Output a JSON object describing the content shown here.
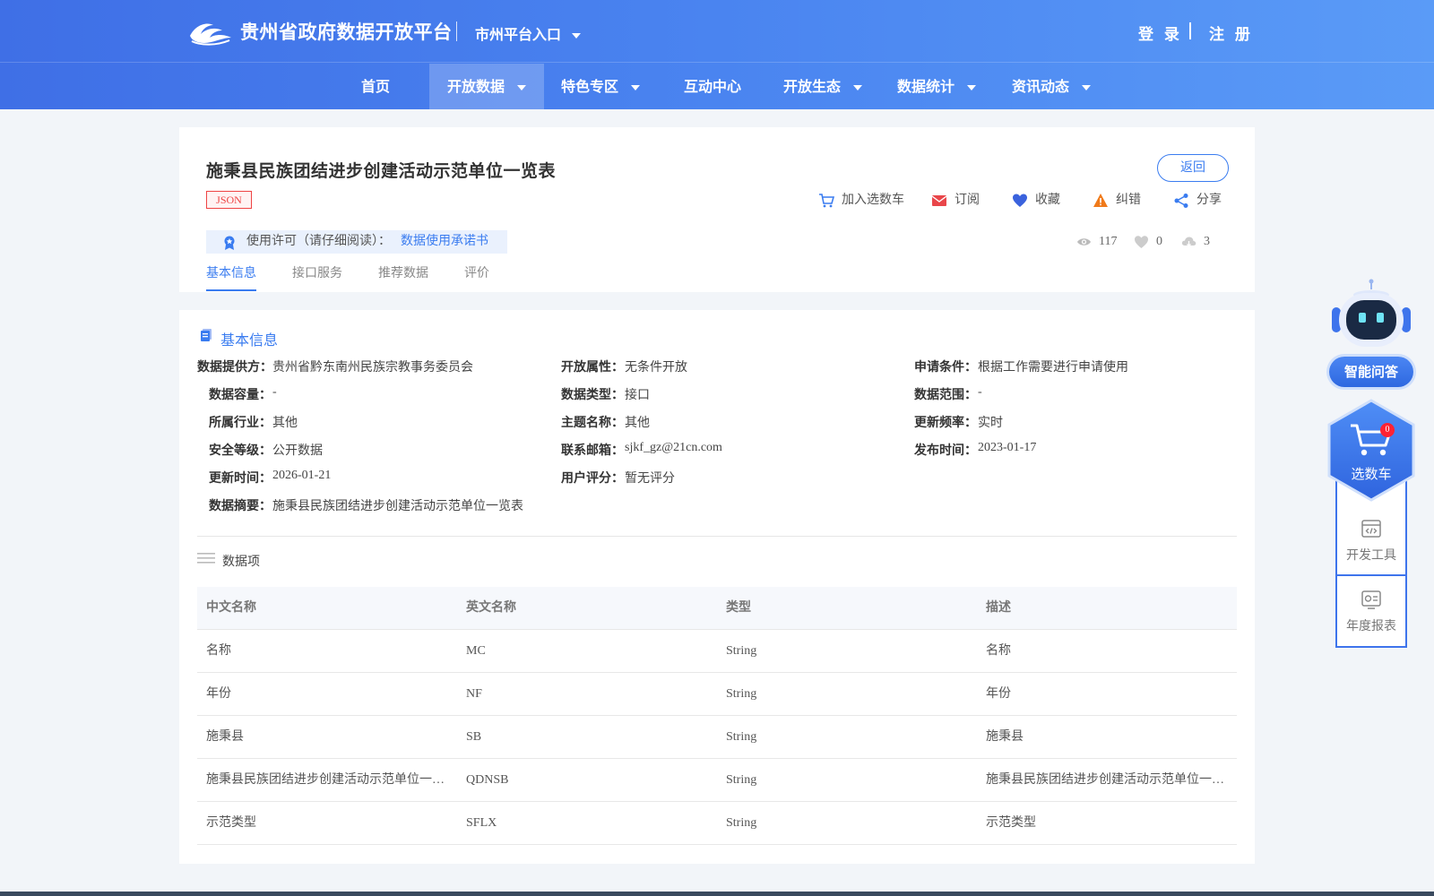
{
  "header": {
    "site_title": "贵州省政府数据开放平台",
    "city_entry": "市州平台入口",
    "login": "登 录",
    "register": "注 册"
  },
  "nav": {
    "items": [
      {
        "label": "首页"
      },
      {
        "label": "开放数据"
      },
      {
        "label": "特色专区"
      },
      {
        "label": "互动中心"
      },
      {
        "label": "开放生态"
      },
      {
        "label": "数据统计"
      },
      {
        "label": "资讯动态"
      }
    ],
    "active": "开放数据"
  },
  "dataset": {
    "title": "施秉县民族团结进步创建活动示范单位一览表",
    "format_badge": "JSON",
    "back_label": "返回",
    "actions": {
      "add_cart": "加入选数车",
      "subscribe": "订阅",
      "favorite": "收藏",
      "report": "纠错",
      "share": "分享"
    },
    "license_text": "使用许可（请仔细阅读）：",
    "license_link": "数据使用承诺书",
    "stats": {
      "views": "117",
      "likes": "0",
      "downloads": "3"
    },
    "tabs": [
      "基本信息",
      "接口服务",
      "推荐数据",
      "评价"
    ]
  },
  "basic_info": {
    "section_title": "基本信息",
    "fields": {
      "provider": {
        "label": "数据提供方：",
        "value": "贵州省黔东南州民族宗教事务委员会"
      },
      "open_attr": {
        "label": "开放属性：",
        "value": "无条件开放"
      },
      "apply_cond": {
        "label": "申请条件：",
        "value": "根据工作需要进行申请使用"
      },
      "capacity": {
        "label": "数据容量：",
        "value": "-"
      },
      "data_type": {
        "label": "数据类型：",
        "value": "接口"
      },
      "scope": {
        "label": "数据范围：",
        "value": "-"
      },
      "industry": {
        "label": "所属行业：",
        "value": "其他"
      },
      "topic": {
        "label": "主题名称：",
        "value": "其他"
      },
      "frequency": {
        "label": "更新频率：",
        "value": "实时"
      },
      "security": {
        "label": "安全等级：",
        "value": "公开数据"
      },
      "email": {
        "label": "联系邮箱：",
        "value": "sjkf_gz@21cn.com"
      },
      "publish_time": {
        "label": "发布时间：",
        "value": "2023-01-17"
      },
      "update_time": {
        "label": "更新时间：",
        "value": "2026-01-21"
      },
      "rating": {
        "label": "用户评分：",
        "value": "暂无评分"
      },
      "summary": {
        "label": "数据摘要：",
        "value": "施秉县民族团结进步创建活动示范单位一览表"
      }
    }
  },
  "data_items": {
    "section_title": "数据项",
    "columns": [
      "中文名称",
      "英文名称",
      "类型",
      "描述"
    ],
    "rows": [
      [
        "名称",
        "MC",
        "String",
        "名称"
      ],
      [
        "年份",
        "NF",
        "String",
        "年份"
      ],
      [
        "施秉县",
        "SB",
        "String",
        "施秉县"
      ],
      [
        "施秉县民族团结进步创建活动示范单位一览表",
        "QDNSB",
        "String",
        "施秉县民族团结进步创建活动示范单位一览表"
      ],
      [
        "示范类型",
        "SFLX",
        "String",
        "示范类型"
      ]
    ]
  },
  "sidebar": {
    "ai_label": "智能问答",
    "cart_label": "选数车",
    "cart_count": "0",
    "dev_tools": "开发工具",
    "annual_report": "年度报表"
  },
  "colors": {
    "primary": "#3a7cf0",
    "header_start": "#3f6fe6",
    "header_end": "#5a9bf7",
    "badge_red": "#e44"
  }
}
